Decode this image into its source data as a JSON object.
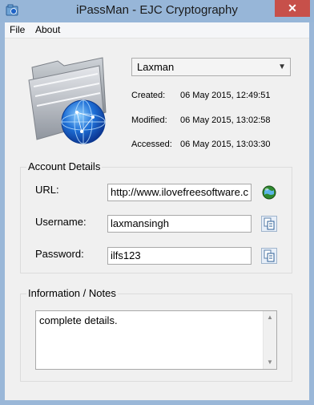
{
  "window": {
    "title": "iPassMan - EJC Cryptography",
    "close_glyph": "✕"
  },
  "menu": {
    "file": "File",
    "about": "About"
  },
  "profile": {
    "selected": "Laxman",
    "created_label": "Created:",
    "created_value": "06 May 2015, 12:49:51",
    "modified_label": "Modified:",
    "modified_value": "06 May 2015, 13:02:58",
    "accessed_label": "Accessed:",
    "accessed_value": "06 May 2015, 13:03:30"
  },
  "account": {
    "legend": "Account Details",
    "url_label": "URL:",
    "url_value": "http://www.ilovefreesoftware.c",
    "username_label": "Username:",
    "username_value": "laxmansingh",
    "password_label": "Password:",
    "password_value": "ilfs123"
  },
  "notes": {
    "legend": "Information / Notes",
    "text": "complete details."
  },
  "colors": {
    "frame": "#9ab7d8",
    "close": "#c7504a",
    "client": "#f0f0f0"
  },
  "icons": {
    "app": "app-icon",
    "folder": "network-folder-icon",
    "globe": "globe-icon",
    "copy": "copy-icon"
  }
}
